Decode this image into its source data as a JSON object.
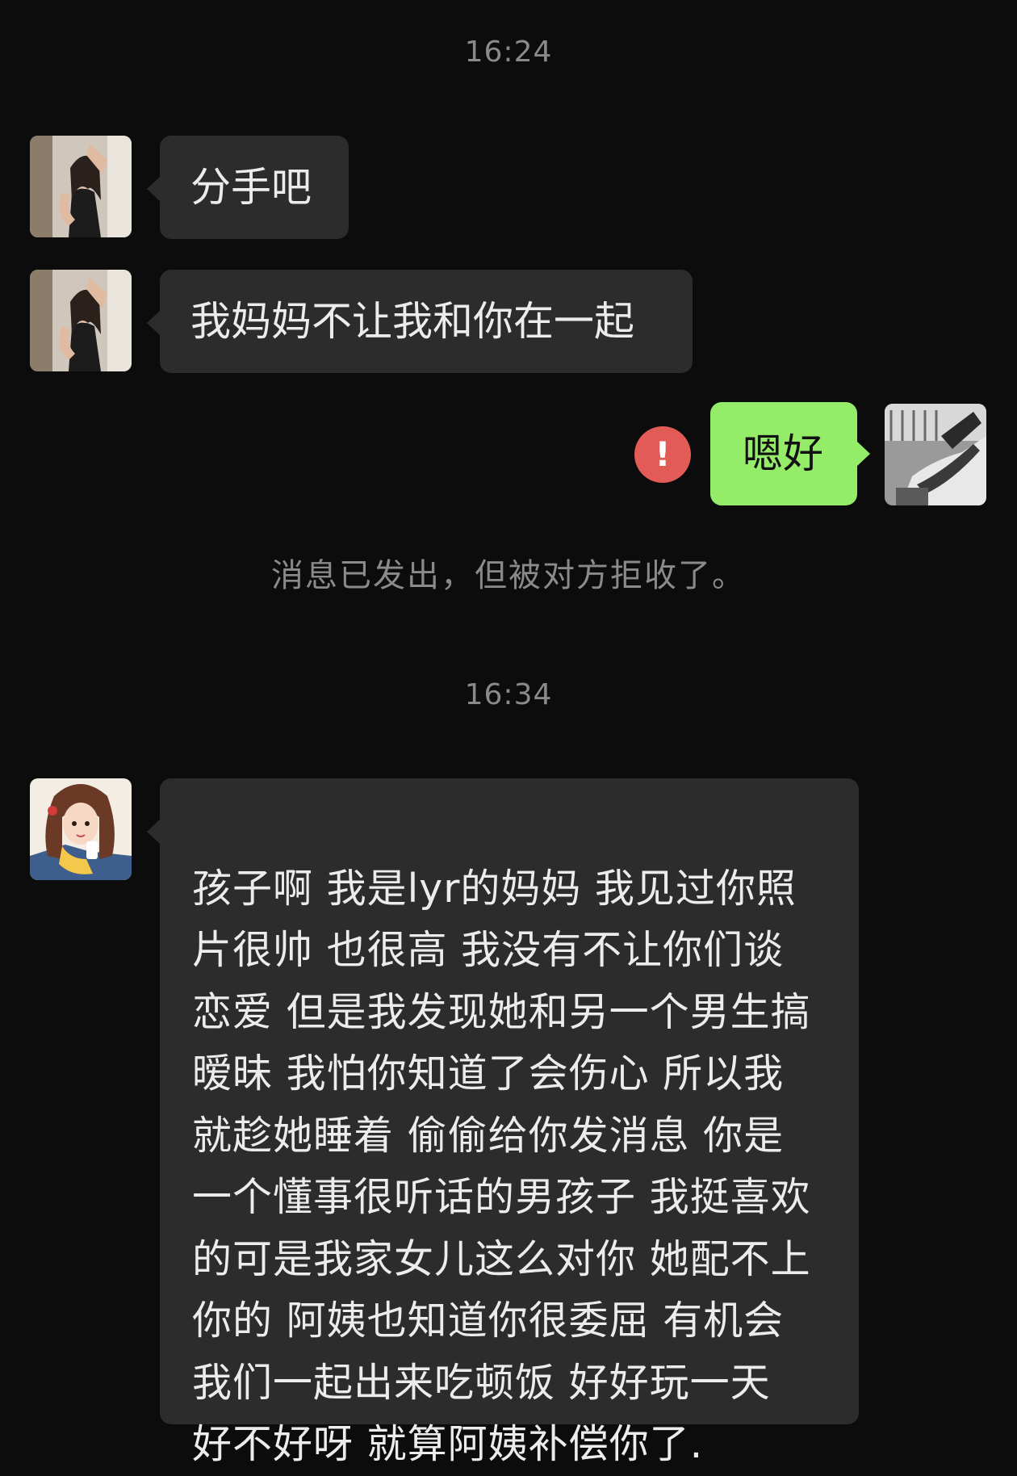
{
  "chat": {
    "time_1": "16:24",
    "msg_1": "分手吧",
    "msg_2": "我妈妈不让我和你在一起",
    "msg_3": "嗯好",
    "failed_icon": "!",
    "rejected_note": "消息已发出，但被对方拒收了。",
    "time_2": "16:34",
    "msg_4": "孩子啊 我是lyr的妈妈 我见过你照\n片很帅 也很高 我没有不让你们谈\n恋爱 但是我发现她和另一个男生搞\n暧昧 我怕你知道了会伤心 所以我\n就趁她睡着 偷偷给你发消息 你是\n一个懂事很听话的男孩子 我挺喜欢\n的可是我家女儿这么对你 她配不上\n你的 阿姨也知道你很委屈 有机会\n我们一起出来吃顿饭 好好玩一天\n好不好呀 就算阿姨补偿你了."
  },
  "colors": {
    "background": "#0c0c0c",
    "incoming_bubble": "#2c2c2c",
    "outgoing_bubble": "#95ec69",
    "failed_icon": "#e35b57",
    "muted_text": "#8a8a8a"
  },
  "icons": {
    "failed_icon": "exclamation-circle-icon",
    "contact_avatar": "avatar-photo",
    "mother_avatar": "avatar-illustration",
    "self_avatar": "avatar-photo-bw"
  }
}
